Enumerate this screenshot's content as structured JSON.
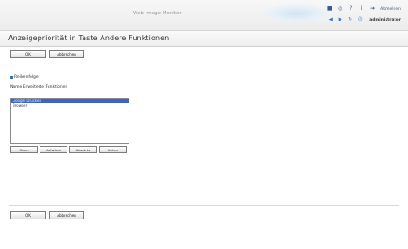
{
  "header": {
    "app_title": "Web Image Monitor",
    "links": [
      {
        "icon": "home-icon",
        "glyph": "■"
      },
      {
        "icon": "search-icon",
        "glyph": "◎"
      },
      {
        "icon": "help-icon",
        "glyph": "?"
      },
      {
        "icon": "info-icon",
        "glyph": "i"
      }
    ],
    "logout_label": "Abmelden",
    "nav_icons": [
      {
        "icon": "back-icon",
        "glyph": "◀"
      },
      {
        "icon": "forward-icon",
        "glyph": "▶"
      },
      {
        "icon": "refresh-icon",
        "glyph": "↻"
      },
      {
        "icon": "user-icon",
        "glyph": "☺"
      }
    ],
    "user": "administrator"
  },
  "page": {
    "title": "Anzeigepriorität in Taste Andere Funktionen"
  },
  "buttons": {
    "ok": "OK",
    "cancel": "Abbrechen"
  },
  "section": {
    "heading": "Reihenfolge",
    "field_label": "Name Erweiterte Funktionen"
  },
  "list": {
    "items": [
      {
        "label": "Google Drucken",
        "selected": true
      },
      {
        "label": "Browser",
        "selected": false
      }
    ]
  },
  "move_buttons": [
    "Oben",
    "Aufwärts",
    "Abwärts",
    "Unten"
  ],
  "colors": {
    "accent": "#3b64c8",
    "bullet": "#3b6fb5",
    "link": "#3a5a8a"
  }
}
